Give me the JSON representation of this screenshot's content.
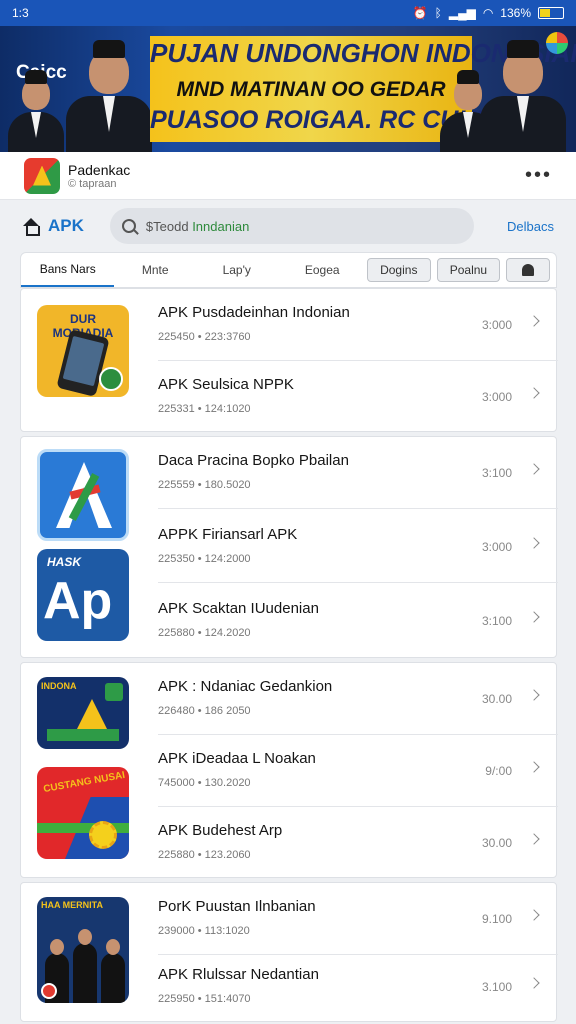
{
  "status_bar": {
    "time": "1:3",
    "battery": "136%",
    "icons": [
      "alarm-icon",
      "bluetooth-icon",
      "signal-icon",
      "wifi-icon",
      "battery-icon"
    ]
  },
  "banner": {
    "logo_text": "Caicc",
    "line1": "PUJAN UNDONGHON INDONESIAI",
    "line2": "MND MATINAN OO GEDAR",
    "line3": "PUASOO ROIGAA. RC CUKTON"
  },
  "app": {
    "name": "Padenkac",
    "subtitle": "© tapraan"
  },
  "nav": {
    "section_label": "APK",
    "search_prefix": "$Teodd",
    "search_value": "Inndanian",
    "action_label": "Delbacs"
  },
  "tabs": [
    {
      "label": "Bans Nars",
      "active": true
    },
    {
      "label": "Mnte",
      "active": false
    },
    {
      "label": "Lap'y",
      "active": false
    },
    {
      "label": "Eogea",
      "active": false
    }
  ],
  "filter_buttons": [
    "Dogins",
    "Poalnu"
  ],
  "tile_captions": {
    "t1": "DUR MOBIADIA",
    "t3": "HASK",
    "t3_big": "Ap",
    "t4": "INDONA",
    "t5": "CUSTANG NUSAI",
    "t6": "HAA MERNITA"
  },
  "cards": [
    {
      "rows": [
        {
          "title": "APK Pusdadeinhan Indonian",
          "meta": "225450 • 223:3760",
          "value": "3:000"
        },
        {
          "title": "APK Seulsica NPPK",
          "meta": "225331 • 124:1020",
          "value": "3:000"
        }
      ]
    },
    {
      "rows": [
        {
          "title": "Daca Pracina Bopko Pbailan",
          "meta": "225559 • 180.5020",
          "value": "3:100"
        },
        {
          "title": "APPK Firiansarl APK",
          "meta": "225350 • 124:2000",
          "value": "3:000"
        },
        {
          "title": "APK Scaktan IUudenian",
          "meta": "225880 • 124.2020",
          "value": "3:100"
        }
      ]
    },
    {
      "rows": [
        {
          "title": "APK : Ndaniac Gedankion",
          "meta": "226480 • 186 2050",
          "value": "30.00"
        },
        {
          "title": "APK iDeadaa L Noakan",
          "meta": "745000 • 130.2020",
          "value": "9/:00"
        },
        {
          "title": "APK Budehest Arp",
          "meta": "225880 • 123.2060",
          "value": "30.00"
        }
      ]
    },
    {
      "rows": [
        {
          "title": "PorK Puustan Ilnbanian",
          "meta": "239000 • 113:1020",
          "value": "9.100"
        },
        {
          "title": "APK Rlulssar Nedantian",
          "meta": "225950 • 151:4070",
          "value": "3.100"
        }
      ]
    }
  ]
}
